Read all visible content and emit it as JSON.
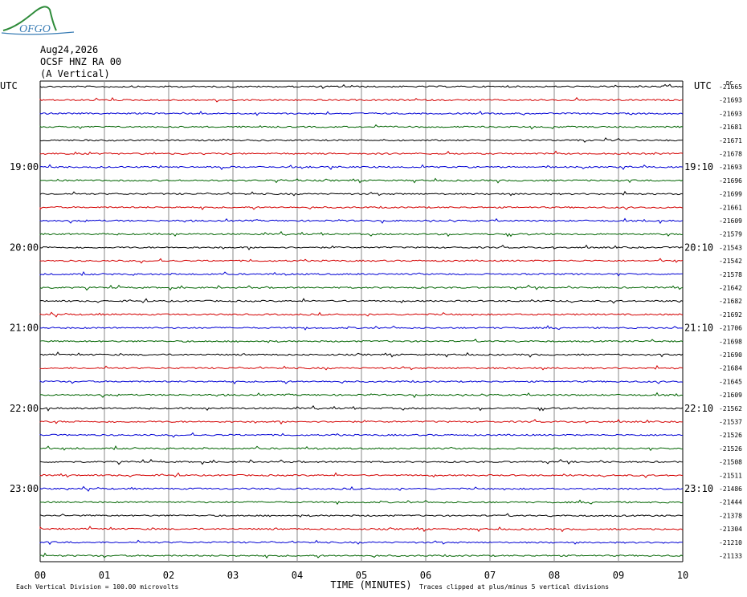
{
  "logo": {
    "text": "OFGO",
    "color": "#3a7db5",
    "accent": "#2e8b3a"
  },
  "header": {
    "date": "Aug24,2026",
    "station": "OCSF HNZ RA 00",
    "component": "(A Vertical)"
  },
  "chart_data": {
    "type": "line",
    "description_free": true,
    "left_axis_label": "UTC",
    "right_axis_label": "UTC",
    "dc_label": "DC",
    "left_hour_labels": [
      {
        "row": 6,
        "text": "19:00"
      },
      {
        "row": 12,
        "text": "20:00"
      },
      {
        "row": 18,
        "text": "21:00"
      },
      {
        "row": 24,
        "text": "22:00"
      },
      {
        "row": 30,
        "text": "23:00"
      }
    ],
    "right_hour_labels": [
      {
        "row": 6,
        "text": "19:10"
      },
      {
        "row": 12,
        "text": "20:10"
      },
      {
        "row": 18,
        "text": "21:10"
      },
      {
        "row": 24,
        "text": "22:10"
      },
      {
        "row": 30,
        "text": "23:10"
      }
    ],
    "dc_offsets": [
      -21665,
      -21693,
      -21693,
      -21681,
      -21671,
      -21678,
      -21693,
      -21696,
      -21699,
      -21661,
      -21609,
      -21579,
      -21543,
      -21542,
      -21578,
      -21642,
      -21682,
      -21692,
      -21706,
      -21698,
      -21690,
      -21684,
      -21645,
      -21609,
      -21562,
      -21537,
      -21526,
      -21526,
      -21508,
      -21511,
      -21486,
      -21444,
      -21378,
      -21304,
      -21210,
      -21133
    ],
    "trace_colors": [
      "#000000",
      "#d40000",
      "#0000d4",
      "#006400"
    ],
    "x_ticks": [
      "00",
      "01",
      "02",
      "03",
      "04",
      "05",
      "06",
      "07",
      "08",
      "09",
      "10"
    ],
    "xlabel": "TIME (MINUTES)",
    "xlim": [
      0,
      10
    ],
    "footer_left": "Each Vertical Division =  100.00 microvolts",
    "footer_right": "Traces clipped at plus/minus 5 vertical divisions",
    "grid": true
  }
}
